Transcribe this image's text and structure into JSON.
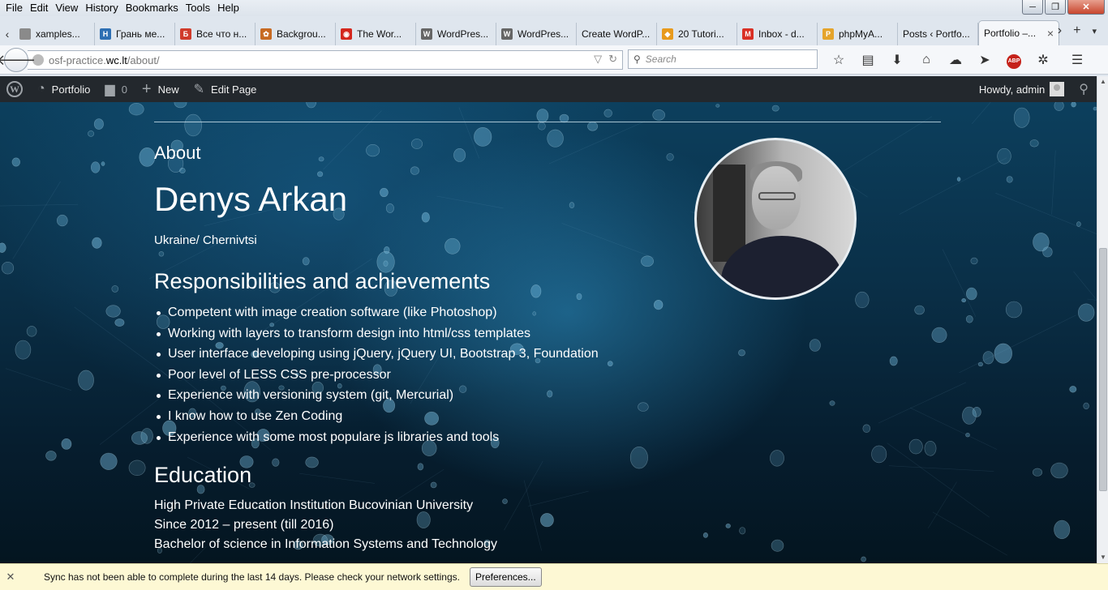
{
  "menu": [
    "File",
    "Edit",
    "View",
    "History",
    "Bookmarks",
    "Tools",
    "Help"
  ],
  "window_controls": [
    "─",
    "❐",
    "✕"
  ],
  "tabs": [
    {
      "label": "xamples...",
      "icon": "page-icon",
      "color": "#8a8a8a",
      "glyph": ""
    },
    {
      "label": "Грань ме...",
      "icon": "h-site-icon",
      "color": "#2d6fb3",
      "glyph": "H"
    },
    {
      "label": "Все что н...",
      "icon": "red-flag-icon",
      "color": "#d03b2b",
      "glyph": "Б"
    },
    {
      "label": "Backgrou...",
      "icon": "gear-site-icon",
      "color": "#c76a22",
      "glyph": "✿"
    },
    {
      "label": "The Wor...",
      "icon": "target-icon",
      "color": "#d4271d",
      "glyph": "◉"
    },
    {
      "label": "WordPres...",
      "icon": "wordpress-icon",
      "color": "#666666",
      "glyph": "W"
    },
    {
      "label": "WordPres...",
      "icon": "wordpress-icon",
      "color": "#666666",
      "glyph": "W"
    },
    {
      "label": "Create WordP...",
      "icon": "blank-icon",
      "color": "",
      "glyph": ""
    },
    {
      "label": "20 Tutori...",
      "icon": "shield-site-icon",
      "color": "#e89a1c",
      "glyph": "◆"
    },
    {
      "label": "Inbox - d...",
      "icon": "gmail-icon",
      "color": "#d93025",
      "glyph": "M"
    },
    {
      "label": "phpMyA...",
      "icon": "pma-icon",
      "color": "#e5a42b",
      "glyph": "P"
    },
    {
      "label": "Posts ‹ Portfo...",
      "icon": "blank-icon",
      "color": "",
      "glyph": ""
    },
    {
      "label": "Portfolio –...",
      "icon": "blank-icon",
      "color": "",
      "glyph": "",
      "active": true
    }
  ],
  "url": {
    "prefix": "osf-practice.",
    "host": "wc.lt",
    "path": "/about/"
  },
  "search": {
    "placeholder": "Search"
  },
  "wpbar": {
    "site": "Portfolio",
    "comments": "0",
    "new_label": "New",
    "edit_label": "Edit Page",
    "howdy": "Howdy, admin"
  },
  "page": {
    "section_label": "About",
    "name": "Denys Arkan",
    "location": "Ukraine/ Chernivtsi",
    "responsibilities_title": "Responsibilities and achievements",
    "responsibilities": [
      "Competent with image creation software (like Photoshop)",
      "Working with layers to transform design into html/css templates",
      "User interface developing using jQuery, jQuery UI, Bootstrap 3, Foundation",
      "Poor level of LESS CSS pre-processor",
      "Experience with versioning system (git, Mercurial)",
      "I know how to use Zen Coding",
      "Experience with some most populare js libraries and tools"
    ],
    "education_title": "Education",
    "education": [
      "High Private Education Institution Bucovinian University",
      "Since 2012 – present (till 2016)",
      "Bachelor of science in Information Systems and Technology"
    ]
  },
  "notification": {
    "message": "Sync has not been able to complete during the last 14 days. Please check your network settings.",
    "button": "Preferences..."
  },
  "colors": {
    "accent_bg": "#0c3f5d",
    "admin_bar": "#23282d",
    "notif_bg": "#fdf8d4"
  }
}
